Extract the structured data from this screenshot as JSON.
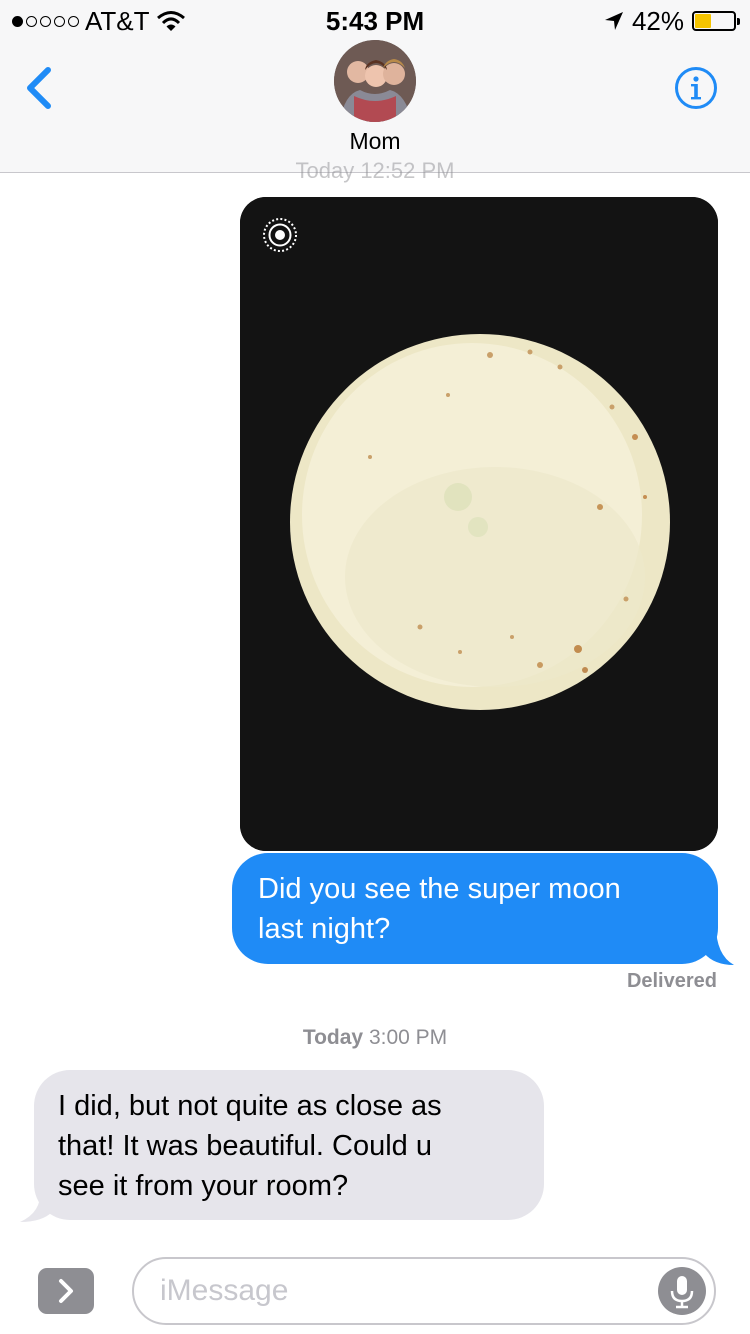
{
  "status_bar": {
    "carrier": "AT&T",
    "time": "5:43 PM",
    "battery_percent": "42%",
    "battery_level": 0.42,
    "signal_bars": 1,
    "signal_bars_total": 5
  },
  "nav": {
    "contact_name": "Mom",
    "back_icon": "chevron-left-icon",
    "info_icon": "info-icon",
    "accent_color": "#1f8bf6",
    "partial_timestamp": "Today 12:52 PM"
  },
  "messages": [
    {
      "type": "image",
      "direction": "sent",
      "description_icon": "live-photo-icon"
    },
    {
      "type": "text",
      "direction": "sent",
      "lines": [
        "Did you see the super moon",
        "last night?"
      ],
      "status": "Delivered"
    },
    {
      "type": "timestamp",
      "day": "Today",
      "time": "3:00 PM"
    },
    {
      "type": "text",
      "direction": "received",
      "lines": [
        "I did, but not quite as close as",
        "that! It was beautiful. Could u",
        "see it from your room?"
      ]
    }
  ],
  "input": {
    "placeholder": "iMessage",
    "apps_icon": "chevron-right-icon",
    "mic_icon": "microphone-icon"
  },
  "colors": {
    "sent_bubble": "#1f8bf6",
    "received_bubble": "#e6e5eb",
    "battery_fill": "#f5c400"
  }
}
